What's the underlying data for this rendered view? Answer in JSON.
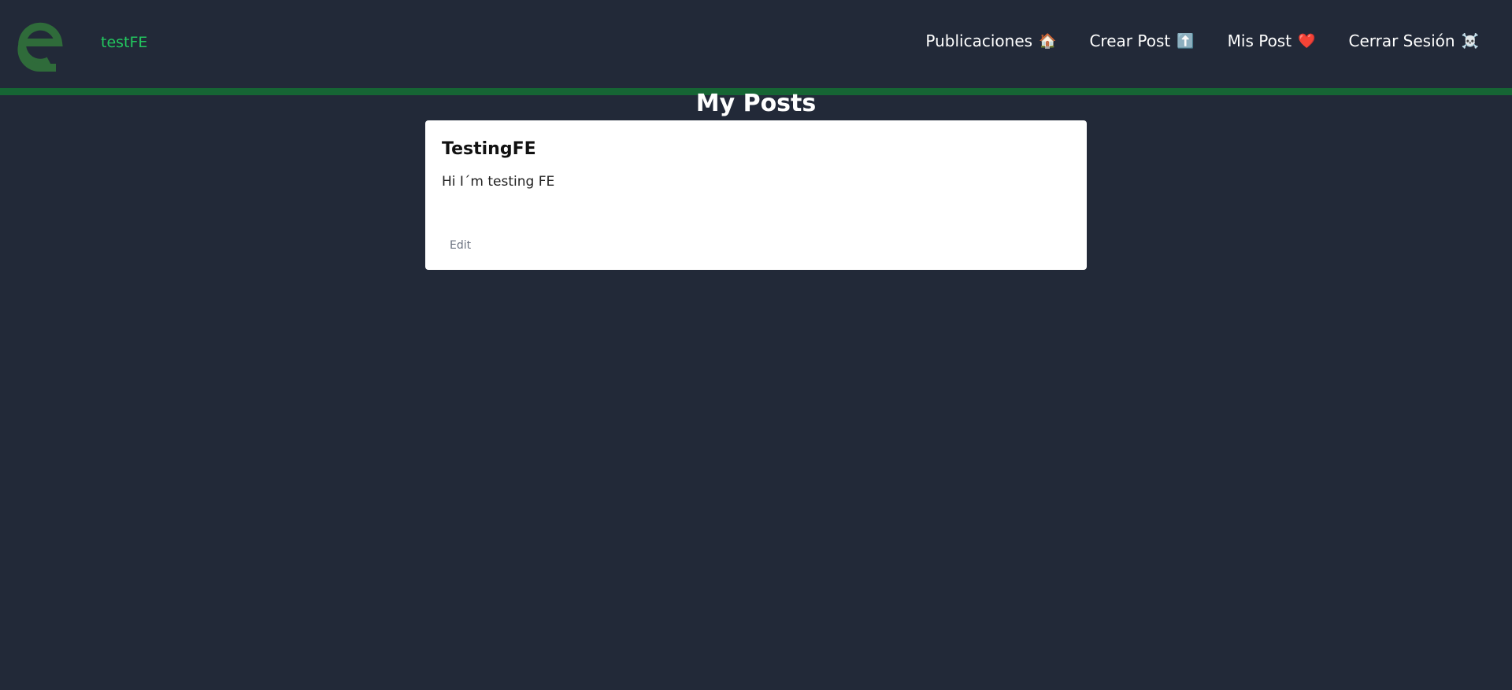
{
  "header": {
    "brand_name": "testFE",
    "nav": [
      {
        "label": "Publicaciones",
        "emoji": "🏠"
      },
      {
        "label": "Crear Post",
        "emoji": "⬆️"
      },
      {
        "label": "Mis Post",
        "emoji": "❤️"
      },
      {
        "label": "Cerrar Sesión",
        "emoji": "☠️"
      }
    ]
  },
  "main": {
    "title": "My Posts",
    "posts": [
      {
        "title": "TestingFE",
        "body": "Hi I´m testing FE",
        "edit_label": "Edit"
      }
    ]
  },
  "colors": {
    "background": "#222938",
    "accent": "#22c55e",
    "divider": "#166534",
    "logo": "#2f6b3a"
  }
}
